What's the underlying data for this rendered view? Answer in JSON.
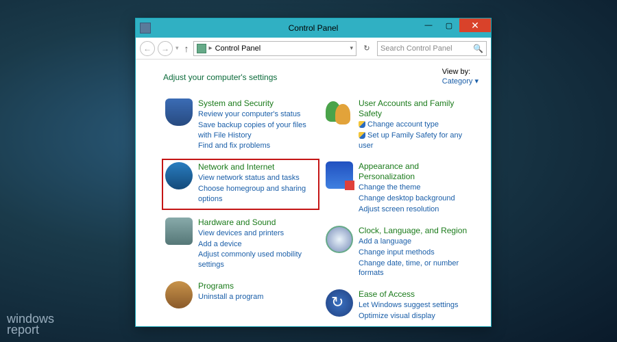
{
  "watermark": {
    "line1": "windows",
    "line2": "report"
  },
  "title": "Control Panel",
  "breadcrumb": "Control Panel",
  "search_placeholder": "Search Control Panel",
  "heading": "Adjust your computer's settings",
  "view_by_label": "View by:",
  "view_by_value": "Category",
  "left": [
    {
      "title": "System and Security",
      "links": [
        "Review your computer's status",
        "Save backup copies of your files with File History",
        "Find and fix problems"
      ]
    },
    {
      "title": "Network and Internet",
      "links": [
        "View network status and tasks",
        "Choose homegroup and sharing options"
      ]
    },
    {
      "title": "Hardware and Sound",
      "links": [
        "View devices and printers",
        "Add a device",
        "Adjust commonly used mobility settings"
      ]
    },
    {
      "title": "Programs",
      "links": [
        "Uninstall a program"
      ]
    }
  ],
  "right": [
    {
      "title": "User Accounts and Family Safety",
      "links": [
        "Change account type",
        "Set up Family Safety for any user"
      ],
      "shielded": [
        true,
        true
      ]
    },
    {
      "title": "Appearance and Personalization",
      "links": [
        "Change the theme",
        "Change desktop background",
        "Adjust screen resolution"
      ]
    },
    {
      "title": "Clock, Language, and Region",
      "links": [
        "Add a language",
        "Change input methods",
        "Change date, time, or number formats"
      ]
    },
    {
      "title": "Ease of Access",
      "links": [
        "Let Windows suggest settings",
        "Optimize visual display"
      ]
    }
  ]
}
